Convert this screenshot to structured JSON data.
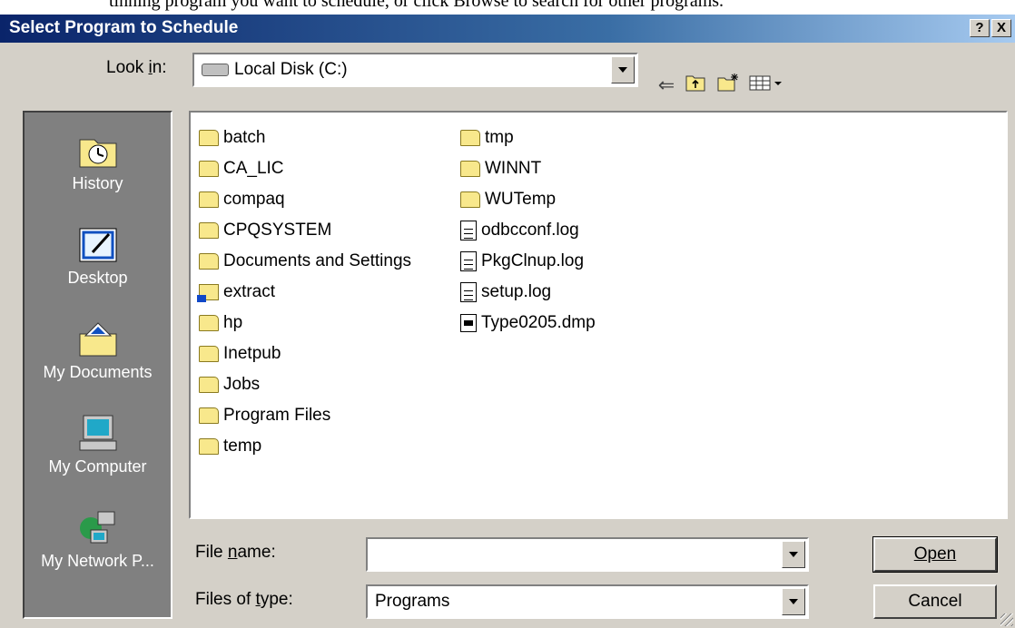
{
  "top_partial_text": "tinning program you want to schedule, or click Browse to search for other programs.",
  "window": {
    "title": "Select Program to Schedule",
    "help_button": "?",
    "close_button": "X"
  },
  "look_in": {
    "label": "Look in:",
    "value": "Local Disk (C:)"
  },
  "toolbar": {
    "icons": [
      "back-icon",
      "up-folder-icon",
      "new-folder-icon",
      "view-menu-icon"
    ]
  },
  "places": [
    {
      "label": "History",
      "icon": "history-icon"
    },
    {
      "label": "Desktop",
      "icon": "desktop-icon"
    },
    {
      "label": "My Documents",
      "icon": "my-documents-icon"
    },
    {
      "label": "My Computer",
      "icon": "my-computer-icon"
    },
    {
      "label": "My Network P...",
      "icon": "network-places-icon"
    }
  ],
  "files": {
    "col1": [
      {
        "name": "batch",
        "type": "folder"
      },
      {
        "name": "CA_LIC",
        "type": "folder"
      },
      {
        "name": "compaq",
        "type": "folder"
      },
      {
        "name": "CPQSYSTEM",
        "type": "folder"
      },
      {
        "name": "Documents and Settings",
        "type": "folder"
      },
      {
        "name": "extract",
        "type": "special"
      },
      {
        "name": "hp",
        "type": "folder"
      },
      {
        "name": "Inetpub",
        "type": "folder"
      },
      {
        "name": "Jobs",
        "type": "folder"
      },
      {
        "name": "Program Files",
        "type": "folder"
      },
      {
        "name": "temp",
        "type": "folder"
      }
    ],
    "col2": [
      {
        "name": "tmp",
        "type": "folder"
      },
      {
        "name": "WINNT",
        "type": "folder"
      },
      {
        "name": "WUTemp",
        "type": "folder"
      },
      {
        "name": "odbcconf.log",
        "type": "doc"
      },
      {
        "name": "PkgClnup.log",
        "type": "doc"
      },
      {
        "name": "setup.log",
        "type": "doc"
      },
      {
        "name": "Type0205.dmp",
        "type": "dmp"
      }
    ]
  },
  "file_name": {
    "label": "File name:",
    "value": ""
  },
  "files_of_type": {
    "label": "Files of type:",
    "value": "Programs"
  },
  "buttons": {
    "open": "Open",
    "cancel": "Cancel"
  }
}
